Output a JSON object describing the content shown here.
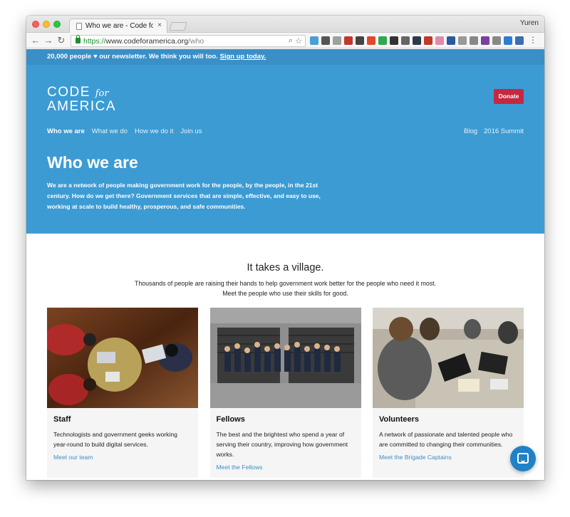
{
  "browser": {
    "tab_title": "Who we are - Code for America",
    "tab_close": "×",
    "profile_name": "Yuren",
    "url_scheme": "https://",
    "url_host": "www.codeforamerica.org",
    "url_path": "/who",
    "extension_colors": [
      "#4a9fd8",
      "#555555",
      "#a0a0a0",
      "#c0392b",
      "#444444",
      "#e04a2b",
      "#2fa84f",
      "#333333",
      "#666666",
      "#2d3a4a",
      "#c0392b",
      "#e08ab0",
      "#2c5aa0",
      "#999999",
      "#888888",
      "#7b3fa0",
      "#888888",
      "#2d7dd2",
      "#3a6fb0"
    ]
  },
  "newsletter": {
    "text": "20,000 people ♥ our newsletter. We think you will too.",
    "link": "Sign up today."
  },
  "header": {
    "logo_line1": "CODE",
    "logo_for": "for",
    "logo_line2": "AMERICA",
    "donate_label": "Donate",
    "nav": [
      "Who we are",
      "What we do",
      "How we do it",
      "Join us"
    ],
    "right_nav": [
      "Blog",
      "2016 Summit"
    ]
  },
  "hero": {
    "title": "Who we are",
    "text": "We are a network of people making government work for the people, by the people, in the 21st century. How do we get there? Government services that are simple, effective, and easy to use, working at scale to build healthy, prosperous, and safe communities."
  },
  "village": {
    "heading": "It takes a village.",
    "text": "Thousands of people are raising their hands to help government work better for the people who need it most. Meet the people who use their skills for good."
  },
  "cards": [
    {
      "title": "Staff",
      "desc": "Technologists and government geeks working year-round to build digital services.",
      "link": "Meet our team"
    },
    {
      "title": "Fellows",
      "desc": "The best and the brightest who spend a year of serving their country, improving how government works.",
      "link": "Meet the Fellows"
    },
    {
      "title": "Volunteers",
      "desc": "A network of passionate and talented people who are committed to changing their communities.",
      "link": "Meet the Brigade Captains"
    }
  ],
  "colors": {
    "hero_blue": "#3c9bd3",
    "news_blue": "#3a8fc7",
    "donate_red": "#c6283f",
    "link_blue": "#3b8fc6"
  }
}
